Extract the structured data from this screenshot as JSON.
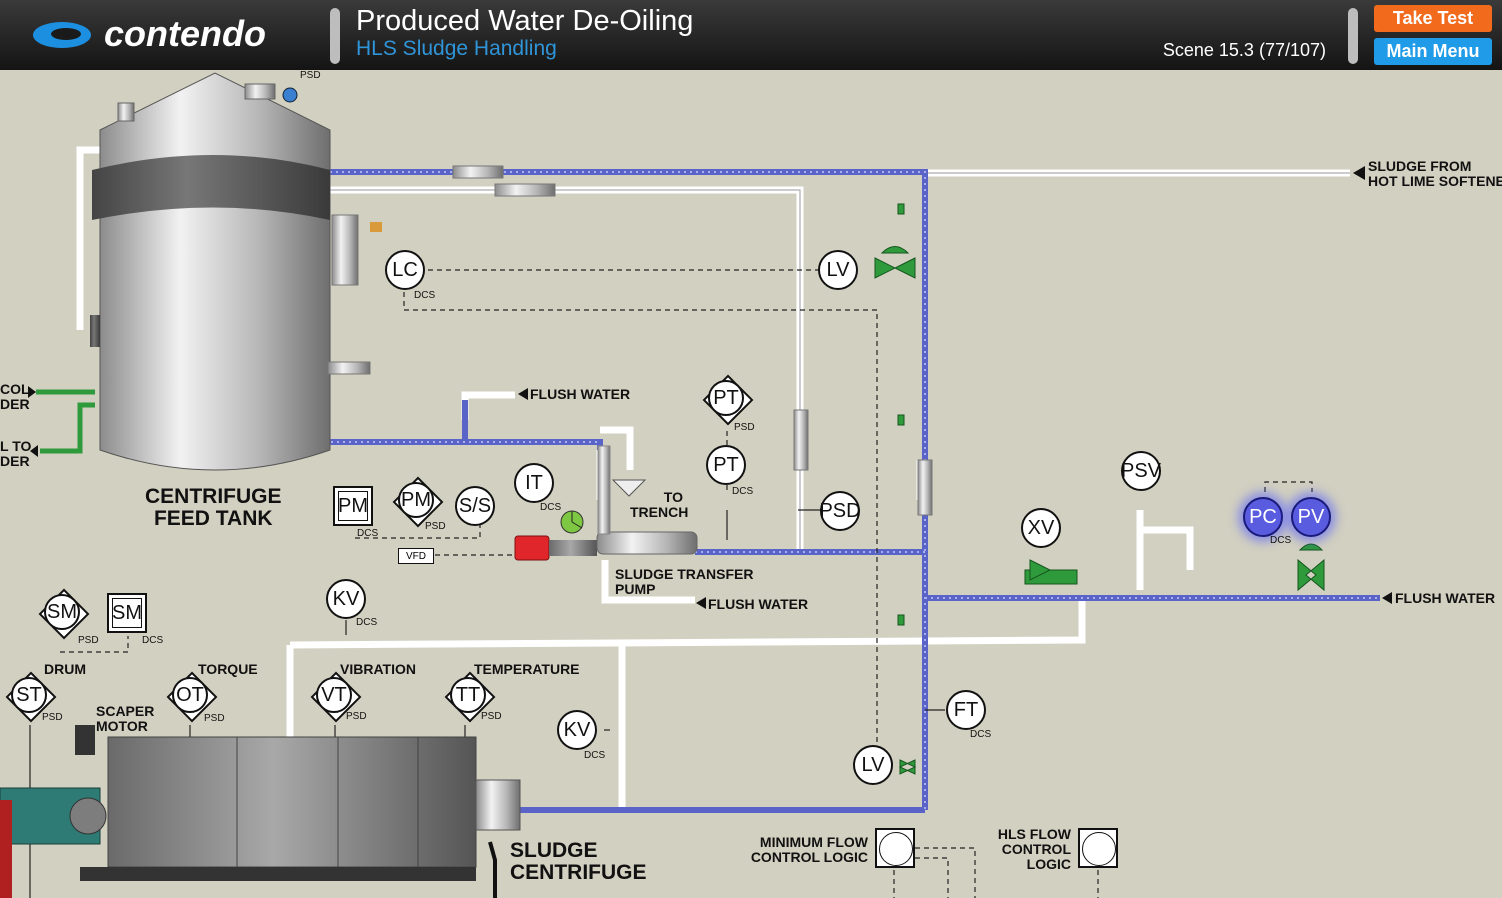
{
  "header": {
    "logo_text": "contendo",
    "title": "Produced Water De-Oiling",
    "subtitle": "HLS Sludge Handling",
    "scene": "Scene 15.3 (77/107)",
    "take_test_label": "Take Test",
    "main_menu_label": "Main Menu"
  },
  "labels": {
    "centrifuge_feed_tank": "CENTRIFUGE\nFEED TANK",
    "sludge_from": "SLUDGE FROM\nHOT LIME SOFTENER",
    "flush_water_1": "FLUSH WATER",
    "flush_water_2": "FLUSH WATER",
    "flush_water_3": "FLUSH WATER",
    "to_trench": "TO\nTRENCH",
    "sludge_transfer_pump": "SLUDGE TRANSFER\nPUMP",
    "col_der": "COL\nDER",
    "to_der": "L TO\nDER",
    "drum": "DRUM",
    "torque": "TORQUE",
    "vibration": "VIBRATION",
    "temperature": "TEMPERATURE",
    "scaper_motor": "SCAPER\nMOTOR",
    "sludge_centrifuge": "SLUDGE\nCENTRIFUGE",
    "min_flow_logic": "MINIMUM FLOW\nCONTROL LOGIC",
    "hls_flow_logic": "HLS FLOW\nCONTROL\nLOGIC",
    "vfd": "VFD"
  },
  "instruments": {
    "lc": {
      "label": "LC",
      "tag": "DCS"
    },
    "lv_top": {
      "label": "LV"
    },
    "pt_psd": {
      "label": "PT",
      "tag": "PSD"
    },
    "pt_dcs": {
      "label": "PT",
      "tag": "DCS"
    },
    "psd": {
      "label": "PSD"
    },
    "psv": {
      "label": "PSV"
    },
    "xv": {
      "label": "XV"
    },
    "pc": {
      "label": "PC",
      "tag": "DCS"
    },
    "pv": {
      "label": "PV"
    },
    "pm_sq": {
      "label": "PM",
      "tag": "DCS"
    },
    "pm_dia": {
      "label": "PM",
      "tag": "PSD"
    },
    "ss": {
      "label": "S/S"
    },
    "it": {
      "label": "IT",
      "tag": "DCS"
    },
    "kv_top": {
      "label": "KV",
      "tag": "DCS"
    },
    "kv_mid": {
      "label": "KV",
      "tag": "DCS"
    },
    "ft": {
      "label": "FT",
      "tag": "DCS"
    },
    "lv_bottom": {
      "label": "LV"
    },
    "sm_dia": {
      "label": "SM",
      "tag": "PSD"
    },
    "sm_sq": {
      "label": "SM",
      "tag": "DCS"
    },
    "st": {
      "label": "ST",
      "tag": "PSD"
    },
    "ot": {
      "label": "OT",
      "tag": "PSD"
    },
    "vt": {
      "label": "VT",
      "tag": "PSD"
    },
    "tt": {
      "label": "TT",
      "tag": "PSD"
    },
    "psd_top": {
      "tag": "PSD"
    }
  },
  "colors": {
    "background": "#d2d0c0",
    "header_title": "#ffffff",
    "header_subtitle": "#2f95d8",
    "take_test": "#f26a1b",
    "main_menu": "#1f9be8",
    "pipe_blue": "#5a63c8",
    "pipe_gray": "#e4e4e4",
    "valve_green": "#2f9a3c",
    "pump_red": "#e0262a",
    "highlight_blue": "#5a5ce0"
  }
}
